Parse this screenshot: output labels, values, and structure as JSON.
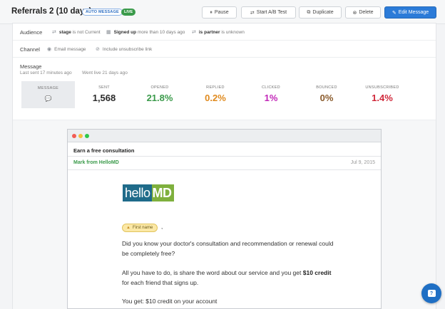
{
  "header": {
    "title": "Referrals 2 (10 days)",
    "badge_auto": "AUTO MESSAGE",
    "badge_live": "LIVE",
    "buttons": [
      {
        "label": "Pause",
        "icon": "pause-icon",
        "glyph": "⏸"
      },
      {
        "label": "Start A/B Test",
        "icon": "ab-test-icon",
        "glyph": "⇄"
      },
      {
        "label": "Duplicate",
        "icon": "duplicate-icon",
        "glyph": "⧉"
      },
      {
        "label": "Delete",
        "icon": "delete-icon",
        "glyph": "⊗"
      },
      {
        "label": "Edit Message",
        "icon": "pencil-icon",
        "glyph": "✎"
      }
    ]
  },
  "audience": {
    "label": "Audience",
    "conditions": [
      {
        "icon": "filter-icon",
        "glyph": "⇄",
        "attr": "stage",
        "rest": "is not Current"
      },
      {
        "icon": "calendar-icon",
        "glyph": "▦",
        "attr": "Signed up",
        "rest": "more than 10 days ago"
      },
      {
        "icon": "filter-icon",
        "glyph": "⇄",
        "attr": "is partner",
        "rest": "is unknown"
      }
    ]
  },
  "channel": {
    "label": "Channel",
    "email": "Email message",
    "unsubscribe": "Include unsubscribe link"
  },
  "message": {
    "label": "Message",
    "last_sent": "Last sent 17 minutes ago",
    "went_live": "Went live 21 days ago",
    "box_label": "MESSAGE"
  },
  "stats": [
    {
      "label": "SENT",
      "value": "1,568",
      "color": "#2b2b2b"
    },
    {
      "label": "OPENED",
      "value": "21.8%",
      "color": "#3a9a4a"
    },
    {
      "label": "REPLIED",
      "value": "0.2%",
      "color": "#e08a1e"
    },
    {
      "label": "CLICKED",
      "value": "1%",
      "color": "#c227b8"
    },
    {
      "label": "BOUNCED",
      "value": "0%",
      "color": "#8a5a2b"
    },
    {
      "label": "UNSUBSCRIBED",
      "value": "1.4%",
      "color": "#d0283a"
    }
  ],
  "email": {
    "subject": "Earn a free consultation",
    "from": "Mark from HelloMD",
    "date": "Jul 9, 2015",
    "logo_a": "hello",
    "logo_b": "MD",
    "token": "First name",
    "comma": ",",
    "p1": "Did you know your doctor's consultation and recommendation or renewal could be completely free?",
    "p2_a": "All you have to do, is share the word about our service and you get ",
    "p2_b": "$10 credit",
    "p2_c": " for each friend that signs up.",
    "p3": "You get: $10 credit on your account"
  },
  "colors": {
    "primary": "#2b7bd8",
    "live_green": "#3a9a4a",
    "logo_blue": "#1f6b8a",
    "logo_green": "#7fb03d"
  }
}
